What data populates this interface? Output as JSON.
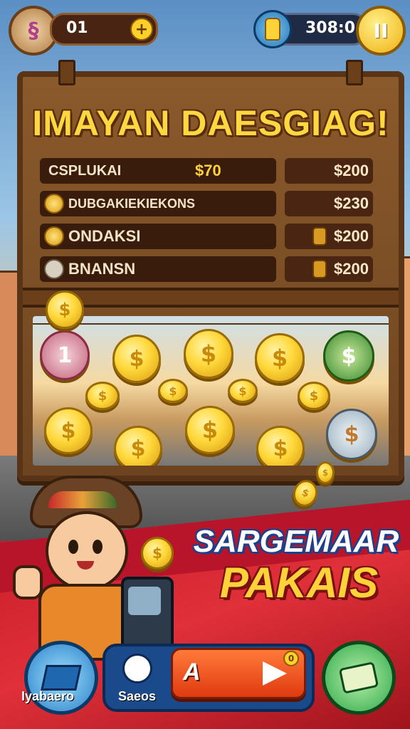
{
  "topbar": {
    "level_value": "01",
    "plus_label": "+",
    "currency_value": "308:0",
    "pause_label": "II"
  },
  "board": {
    "title": "IMAYAN DAESGIAG!",
    "rows": [
      {
        "name": "CSPLUKAI",
        "mid_price": "$70",
        "price": "$200"
      },
      {
        "name": "DUBGAKIEKIEKONS",
        "price": "$230"
      },
      {
        "name": "ONDAKSI",
        "price": "$200"
      },
      {
        "name": "BNANSN",
        "price": "$200"
      }
    ]
  },
  "promo": {
    "line1": "SARGEMAAR",
    "line2": "PAKAIS"
  },
  "bottom": {
    "left_label": "Iyabaero",
    "nav_label": "Saeos",
    "cta_letter": "A",
    "badge": "0"
  },
  "colors": {
    "accent_gold": "#ffd740",
    "wood": "#6d4420",
    "nav_blue": "#1a4a8a",
    "cta_orange": "#e03a10",
    "green_button": "#2ea84a"
  }
}
